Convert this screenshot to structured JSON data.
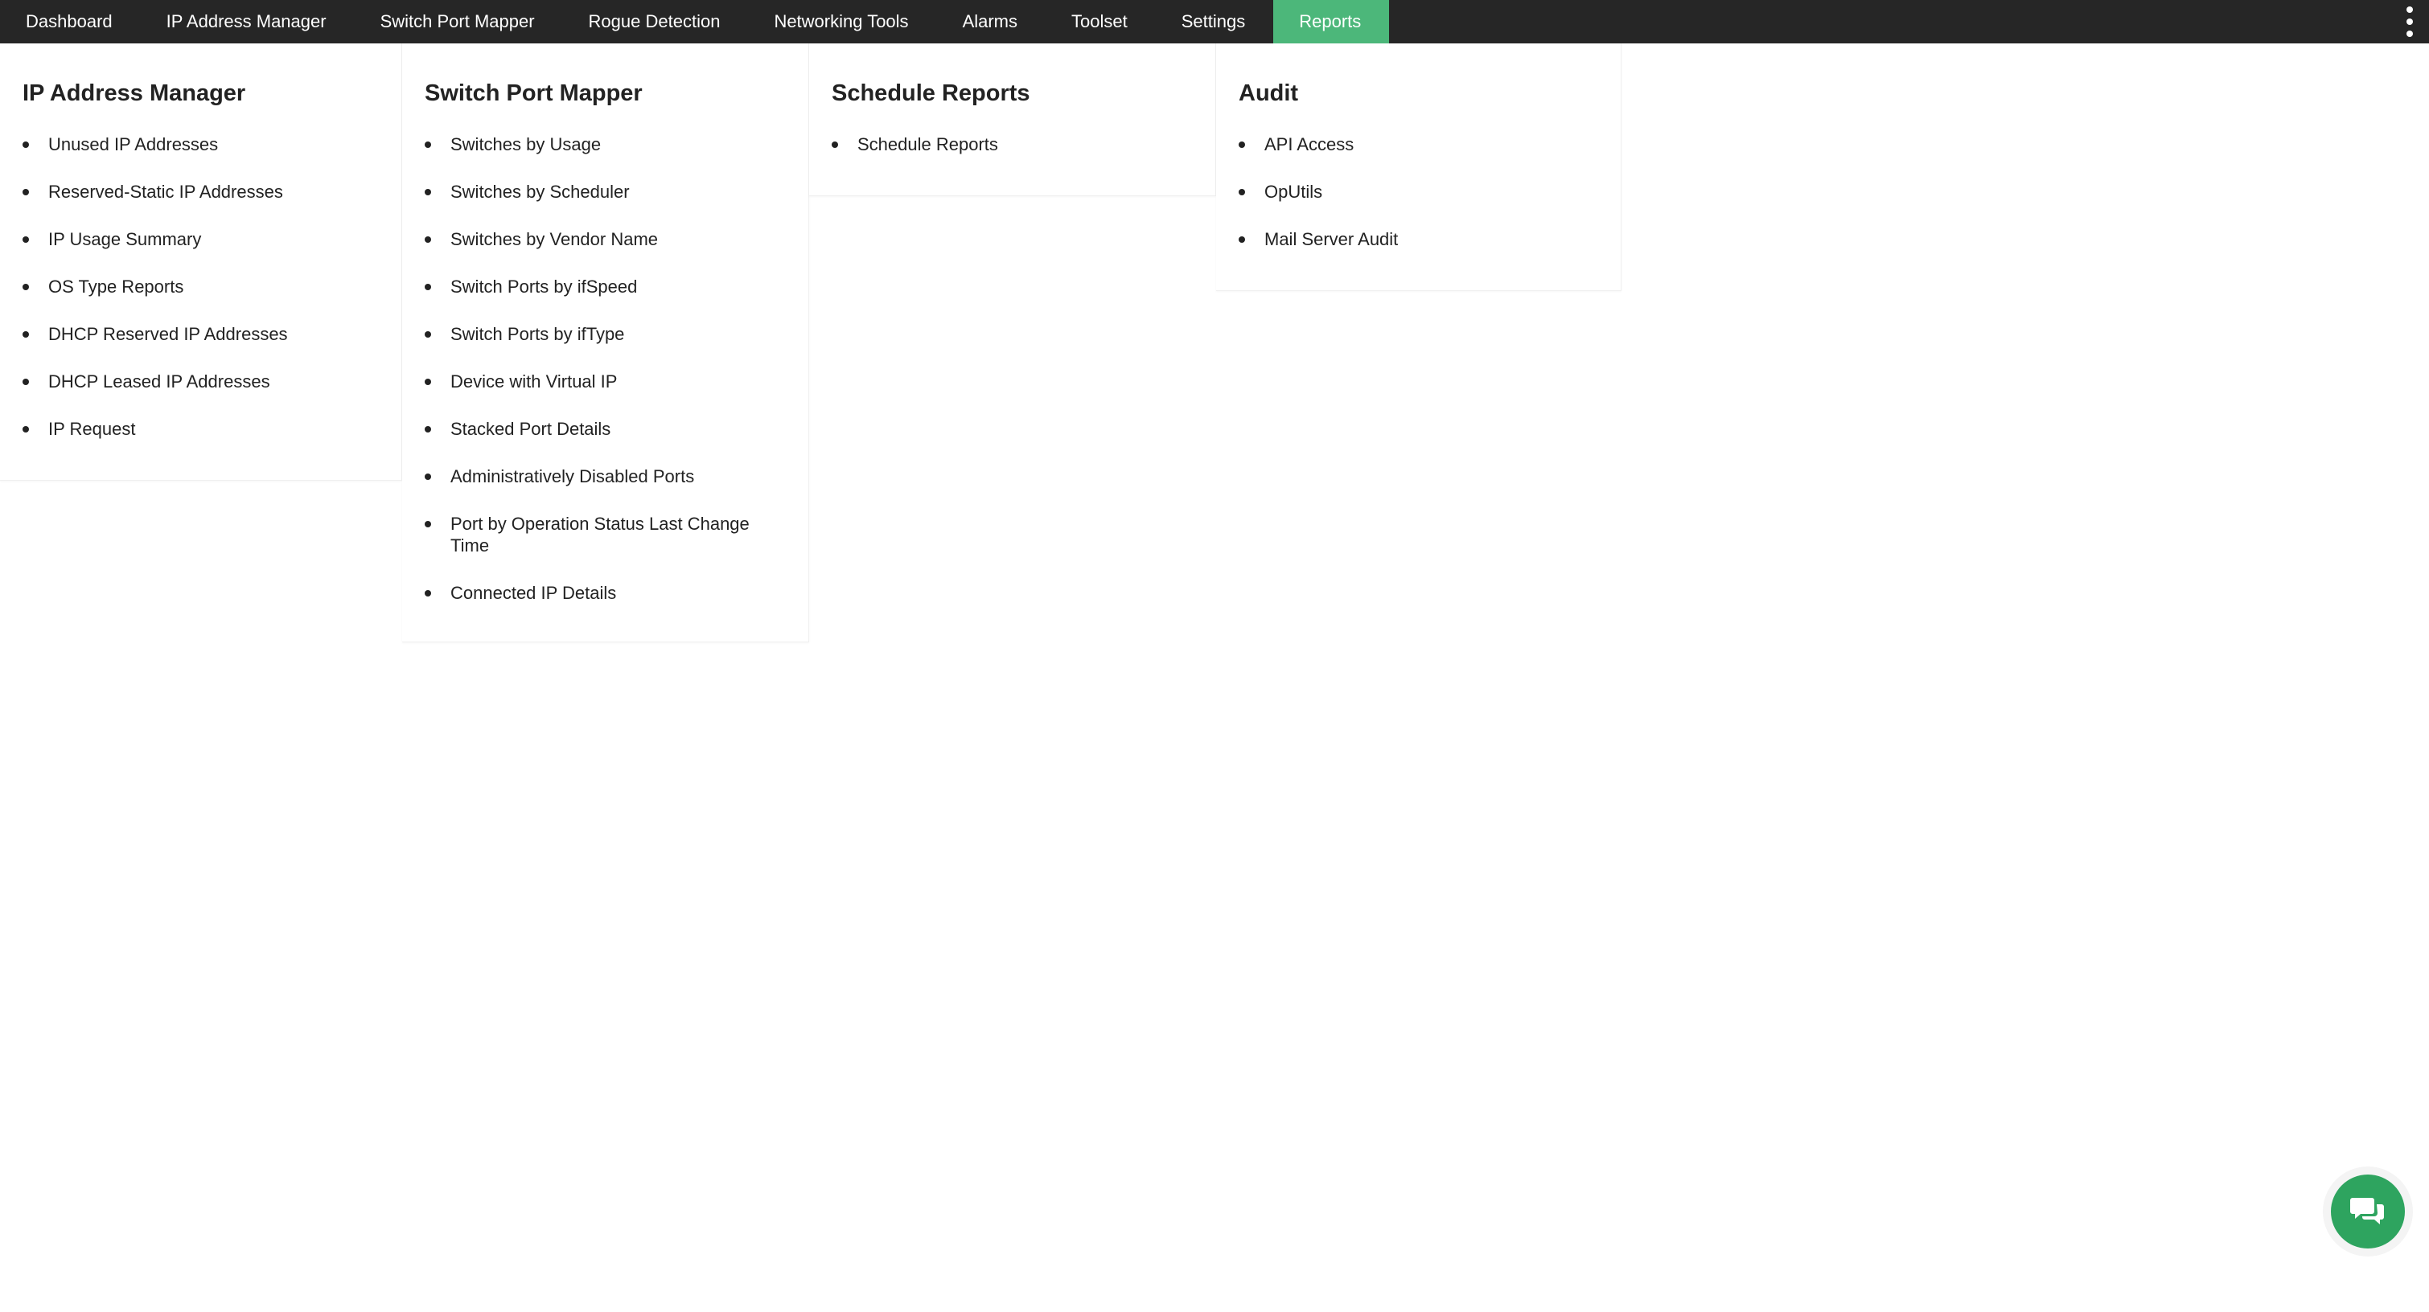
{
  "nav": {
    "items": [
      {
        "label": "Dashboard"
      },
      {
        "label": "IP Address Manager"
      },
      {
        "label": "Switch Port Mapper"
      },
      {
        "label": "Rogue Detection"
      },
      {
        "label": "Networking Tools"
      },
      {
        "label": "Alarms"
      },
      {
        "label": "Toolset"
      },
      {
        "label": "Settings"
      },
      {
        "label": "Reports",
        "active": true
      }
    ],
    "more_icon": "kebab-menu-icon",
    "active_color": "#4cb77a",
    "bar_color": "#262626"
  },
  "panels": [
    {
      "title": "IP Address Manager",
      "items": [
        "Unused IP Addresses",
        "Reserved-Static IP Addresses",
        "IP Usage Summary",
        "OS Type Reports",
        "DHCP Reserved IP Addresses",
        "DHCP Leased IP Addresses",
        "IP Request"
      ]
    },
    {
      "title": "Switch Port Mapper",
      "items": [
        "Switches by Usage",
        "Switches by Scheduler",
        "Switches by Vendor Name",
        "Switch Ports by ifSpeed",
        "Switch Ports by ifType",
        "Device with Virtual IP",
        "Stacked Port Details",
        "Administratively Disabled Ports",
        "Port by Operation Status Last Change Time",
        "Connected IP Details"
      ]
    },
    {
      "title": "Schedule Reports",
      "items": [
        "Schedule Reports"
      ]
    },
    {
      "title": "Audit",
      "items": [
        "API Access",
        "OpUtils",
        "Mail Server Audit"
      ]
    }
  ],
  "chat": {
    "icon": "chat-bubbles-icon",
    "color": "#2ea45f"
  }
}
